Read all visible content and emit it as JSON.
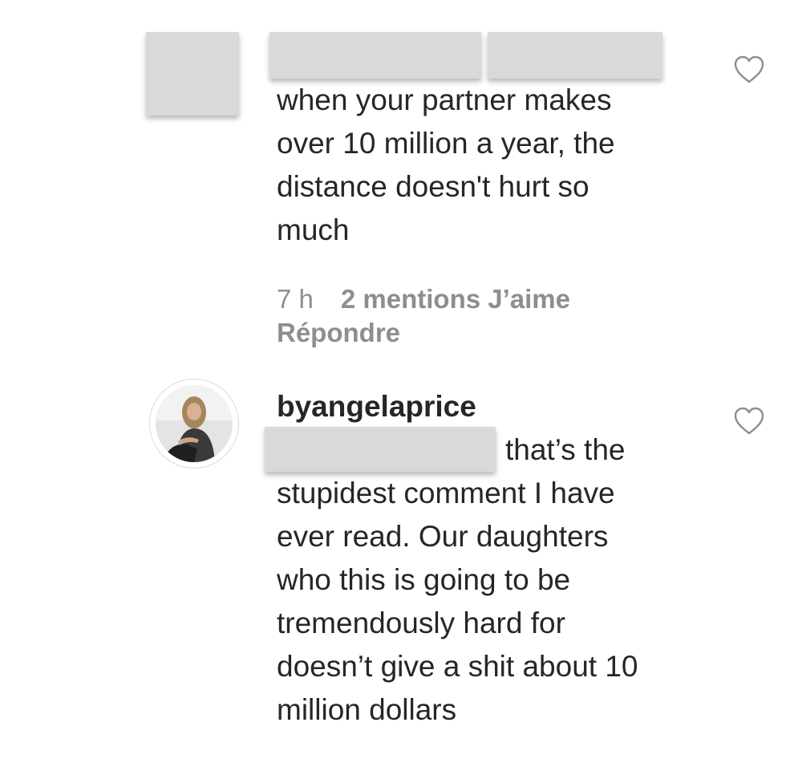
{
  "comments": [
    {
      "username": "",
      "text": "when your partner makes\nover 10 million a year, the\ndistance doesn't hurt so\nmuch",
      "time": "7 h",
      "likes": "2 mentions J’aime",
      "reply": "Répondre",
      "redacted": true
    },
    {
      "username": "byangelaprice",
      "text": "that’s the\nstupidest comment I have\never read. Our daughters\nwho this is going to be\ntremendously hard for\ndoesn’t give a shit about 10\nmillion dollars",
      "redacted_mention": true
    }
  ],
  "icons": {
    "like": "heart-outline-icon",
    "avatar": "profile-photo"
  },
  "colors": {
    "text": "#262626",
    "meta": "#8e8e8e",
    "redaction": "#d9d9d9",
    "avatar_border": "#dbdbdb"
  }
}
